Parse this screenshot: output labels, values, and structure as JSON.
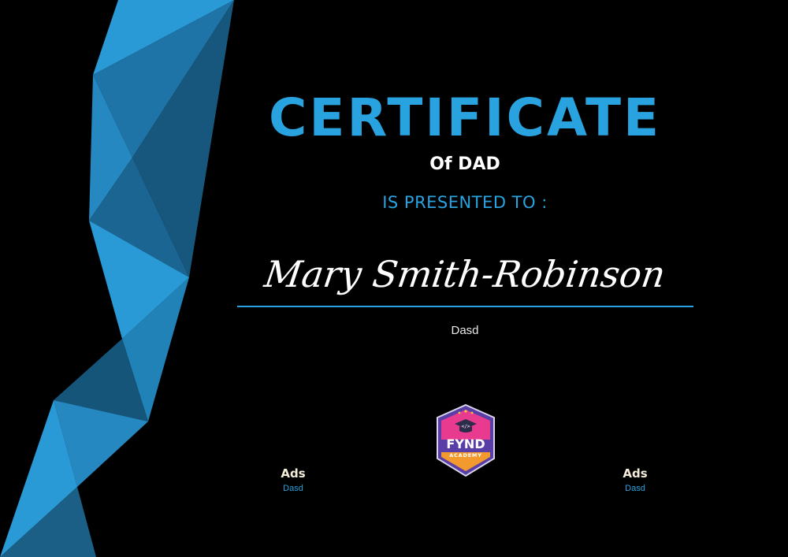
{
  "certificate": {
    "title": "CERTIFICATE",
    "subtitle": "Of DAD",
    "presented_to": "IS PRESENTED TO :",
    "recipient_name": "Mary Smith-Robinson",
    "description": "Dasd"
  },
  "signatures": [
    {
      "name": "Ads",
      "role": "Dasd"
    },
    {
      "name": "Ads",
      "role": "Dasd"
    }
  ],
  "badge": {
    "icon": "graduation-cap-code-icon",
    "line1": "FYND",
    "line2": "ACADEMY"
  },
  "colors": {
    "background": "#000000",
    "accent": "#29a3e0",
    "shard_dark": "#1b5f86",
    "shard_mid": "#2182b8",
    "shard_light": "#2a9ad6",
    "badge_pink": "#e83a8e",
    "badge_purple": "#5a3ea8",
    "badge_orange": "#f29a2e"
  }
}
